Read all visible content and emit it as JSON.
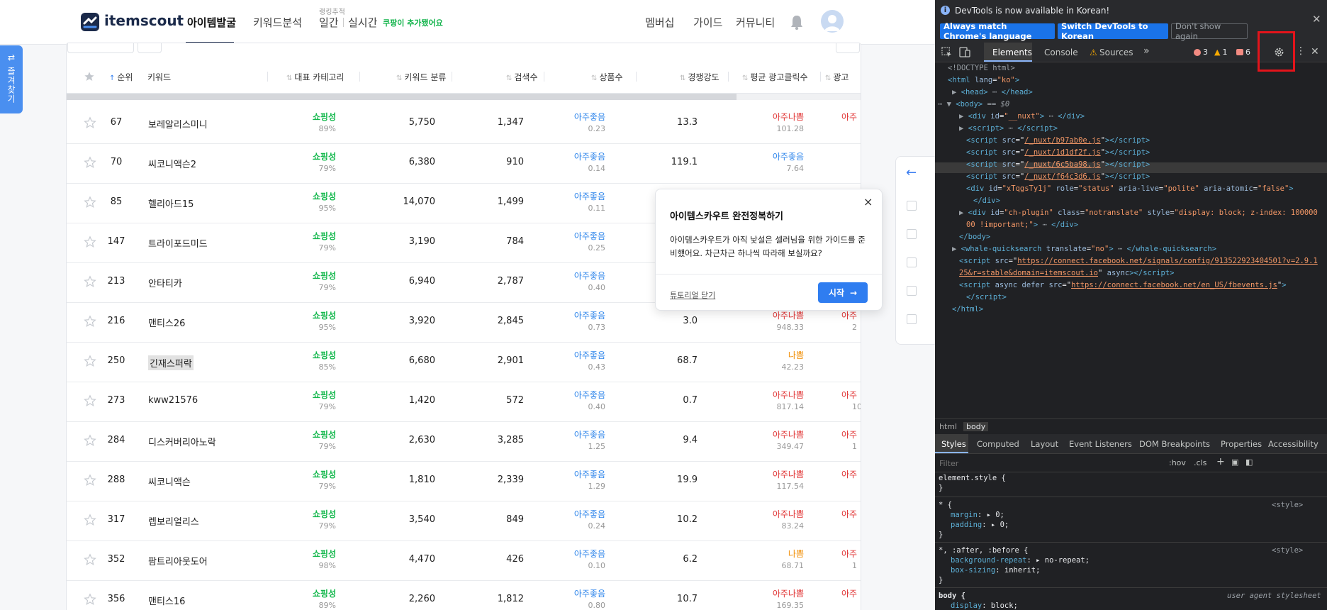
{
  "site": {
    "logo_text": "itemscout",
    "nav": {
      "item_discovery": "아이템발굴",
      "keyword_analysis": "키워드분석",
      "ranking_small": "랭킹추적",
      "daily": "일간",
      "realtime": "실시간",
      "coupang_badge": "쿠팡이 추가됐어요",
      "membership": "멤버십",
      "guide": "가이드",
      "community": "커뮤니티"
    },
    "fav_tab_label": "즐겨찾기",
    "colors": {
      "green": "#14b84d",
      "blue": "#2f86eb",
      "red": "#e03131",
      "orange": "#f08c00",
      "brand": "#1b2a4a"
    }
  },
  "table": {
    "headers": {
      "rank": "순위",
      "keyword": "키워드",
      "category": "대표 카테고리",
      "kw_class": "키워드 분류",
      "searches": "검색수",
      "products": "상품수",
      "competition": "경쟁강도",
      "avg_clicks": "평균 광고클릭수",
      "cut": "광고"
    },
    "rows": [
      {
        "rank": "67",
        "keyword": "보레알리스미니",
        "cat": "쇼핑성",
        "catpct": "89%",
        "kwc": "5,750",
        "search": "1,347",
        "bl": "아주좋음",
        "blv": "0.23",
        "comp": "13.3",
        "ad": "아주나쁨",
        "adv": "101.28",
        "adc": "red",
        "cut": "아주",
        "cutv": ""
      },
      {
        "rank": "70",
        "keyword": "씨코니액슨2",
        "cat": "쇼핑성",
        "catpct": "79%",
        "kwc": "6,380",
        "search": "910",
        "bl": "아주좋음",
        "blv": "0.14",
        "comp": "119.1",
        "ad": "아주좋음",
        "adv": "7.64",
        "adc": "blue",
        "cut": "",
        "cutv": ""
      },
      {
        "rank": "85",
        "keyword": "헬리아드15",
        "cat": "쇼핑성",
        "catpct": "95%",
        "kwc": "14,070",
        "search": "1,499",
        "bl": "아주좋음",
        "blv": "0.11",
        "comp": "",
        "ad": "",
        "adv": "",
        "adc": "red",
        "cut": "",
        "cutv": ""
      },
      {
        "rank": "147",
        "keyword": "트라이포드미드",
        "cat": "쇼핑성",
        "catpct": "79%",
        "kwc": "3,190",
        "search": "784",
        "bl": "아주좋음",
        "blv": "0.25",
        "comp": "",
        "ad": "",
        "adv": "",
        "adc": "red",
        "cut": "",
        "cutv": ""
      },
      {
        "rank": "213",
        "keyword": "안타티카",
        "cat": "쇼핑성",
        "catpct": "79%",
        "kwc": "6,940",
        "search": "2,787",
        "bl": "아주좋음",
        "blv": "0.40",
        "comp": "",
        "ad": "",
        "adv": "",
        "adc": "red",
        "cut": "",
        "cutv": ""
      },
      {
        "rank": "216",
        "keyword": "맨티스26",
        "cat": "쇼핑성",
        "catpct": "95%",
        "kwc": "3,920",
        "search": "2,845",
        "bl": "아주좋음",
        "blv": "0.73",
        "comp": "3.0",
        "ad": "아주나쁨",
        "adv": "948.33",
        "adc": "red",
        "cut": "아주",
        "cutv": "2"
      },
      {
        "rank": "250",
        "keyword": "긴재스퍼락",
        "cat": "쇼핑성",
        "catpct": "85%",
        "kwc": "6,680",
        "search": "2,901",
        "bl": "아주좋음",
        "blv": "0.43",
        "comp": "68.7",
        "ad": "나쁨",
        "adv": "42.23",
        "adc": "orange",
        "cut": "",
        "cutv": ""
      },
      {
        "rank": "273",
        "keyword": "kww21576",
        "cat": "쇼핑성",
        "catpct": "79%",
        "kwc": "1,420",
        "search": "572",
        "bl": "아주좋음",
        "blv": "0.40",
        "comp": "0.7",
        "ad": "아주나쁨",
        "adv": "817.14",
        "adc": "red",
        "cut": "아주",
        "cutv": "10"
      },
      {
        "rank": "284",
        "keyword": "디스커버리아노락",
        "cat": "쇼핑성",
        "catpct": "79%",
        "kwc": "2,630",
        "search": "3,285",
        "bl": "아주좋음",
        "blv": "1.25",
        "comp": "9.4",
        "ad": "아주나쁨",
        "adv": "349.47",
        "adc": "red",
        "cut": "아주",
        "cutv": "1"
      },
      {
        "rank": "288",
        "keyword": "씨코니액슨",
        "cat": "쇼핑성",
        "catpct": "79%",
        "kwc": "1,810",
        "search": "2,339",
        "bl": "아주좋음",
        "blv": "1.29",
        "comp": "19.9",
        "ad": "아주나쁨",
        "adv": "117.54",
        "adc": "red",
        "cut": "아주",
        "cutv": ""
      },
      {
        "rank": "317",
        "keyword": "렙보리얼리스",
        "cat": "쇼핑성",
        "catpct": "79%",
        "kwc": "3,540",
        "search": "849",
        "bl": "아주좋음",
        "blv": "0.24",
        "comp": "10.2",
        "ad": "아주나쁨",
        "adv": "83.24",
        "adc": "red",
        "cut": "아주",
        "cutv": ""
      },
      {
        "rank": "352",
        "keyword": "팜트리아웃도어",
        "cat": "쇼핑성",
        "catpct": "98%",
        "kwc": "4,470",
        "search": "426",
        "bl": "아주좋음",
        "blv": "0.10",
        "comp": "6.2",
        "ad": "나쁨",
        "adv": "68.71",
        "adc": "orange",
        "cut": "아주",
        "cutv": "1"
      },
      {
        "rank": "356",
        "keyword": "맨티스16",
        "cat": "쇼핑성",
        "catpct": "89%",
        "kwc": "2,260",
        "search": "1,812",
        "bl": "아주좋음",
        "blv": "0.80",
        "comp": "10.7",
        "ad": "아주나쁨",
        "adv": "169.35",
        "adc": "red",
        "cut": "아주",
        "cutv": ""
      }
    ]
  },
  "popup": {
    "title": "아이템스카우트 완전정복하기",
    "body": "아이템스카우트가 아직 낯설은 셀러님을 위한 가이드를 준비했어요. 차근차근 하나씩 따라해 보실까요?",
    "close_link": "튜토리얼 닫기",
    "start_button": "시작",
    "close_glyph": "×"
  },
  "devtools": {
    "info": {
      "message": "DevTools is now available in Korean!",
      "btn_match": "Always match Chrome's language",
      "btn_switch": "Switch DevTools to Korean",
      "btn_dont": "Don't show again"
    },
    "tabs": {
      "elements": "Elements",
      "console": "Console",
      "sources": "Sources",
      "more": "»"
    },
    "badges": {
      "errors": "3",
      "warnings": "1",
      "issues": "6"
    },
    "dom": {
      "l1": "<!DOCTYPE html>",
      "l2_tag": "<html",
      "l2_attr": "lang",
      "l2_val": "\"ko\"",
      "l3": "<head>",
      "l3_end": "</head>",
      "l4_body": "<body>",
      "l4_sel": "== $0",
      "l5_attr": "id",
      "l5_val": "\"__nuxt\"",
      "l6": "<script>",
      "s1": "/_nuxt/b97ab0e.js",
      "s2": "/_nuxt/1d1df2f.js",
      "s3": "/_nuxt/6c5ba98.js",
      "s4": "/_nuxt/f64c3d6.js",
      "status_id": "\"xTqgsTy1j\"",
      "status_role": "\"status\"",
      "status_live": "\"polite\"",
      "status_atomic": "\"false\"",
      "chp_id": "\"ch-plugin\"",
      "chp_class": "\"notranslate\"",
      "chp_style": "\"display: block; z-index: 100000",
      "chp_style2": "00 !important;\"",
      "whale": "whale-quicksearch",
      "whale_attr": "\"no\"",
      "fb_src": "https://connect.facebook.net/signals/config/913522923404501?v=2.9.1",
      "fb_src2": "25&r=stable&domain=itemscout.io",
      "fb_events": "https://connect.facebook.net/en_US/fbevents.js"
    },
    "crumbs": {
      "html": "html",
      "body": "body"
    },
    "style_tabs": {
      "styles": "Styles",
      "computed": "Computed",
      "layout": "Layout",
      "listeners": "Event Listeners",
      "dom_bp": "DOM Breakpoints",
      "props": "Properties",
      "a11y": "Accessibility"
    },
    "filter_placeholder": "Filter",
    "filter_hov": ":hov",
    "filter_cls": ".cls",
    "rules": {
      "r1": "element.style {",
      "r2_sel": "* {",
      "r2_p1": "margin",
      "r2_v1": "0;",
      "r2_p2": "padding",
      "r2_v2": "0;",
      "r2_src": "<style>",
      "r3_sel": "*, :after, :before {",
      "r3_p1": "background-repeat",
      "r3_v1": "no-repeat;",
      "r3_p2": "box-sizing",
      "r3_v2": "inherit;",
      "r3_src": "<style>",
      "r4_sel": "body {",
      "r4_src": "user agent stylesheet",
      "r4_p": "display",
      "r4_v": "block;"
    }
  }
}
